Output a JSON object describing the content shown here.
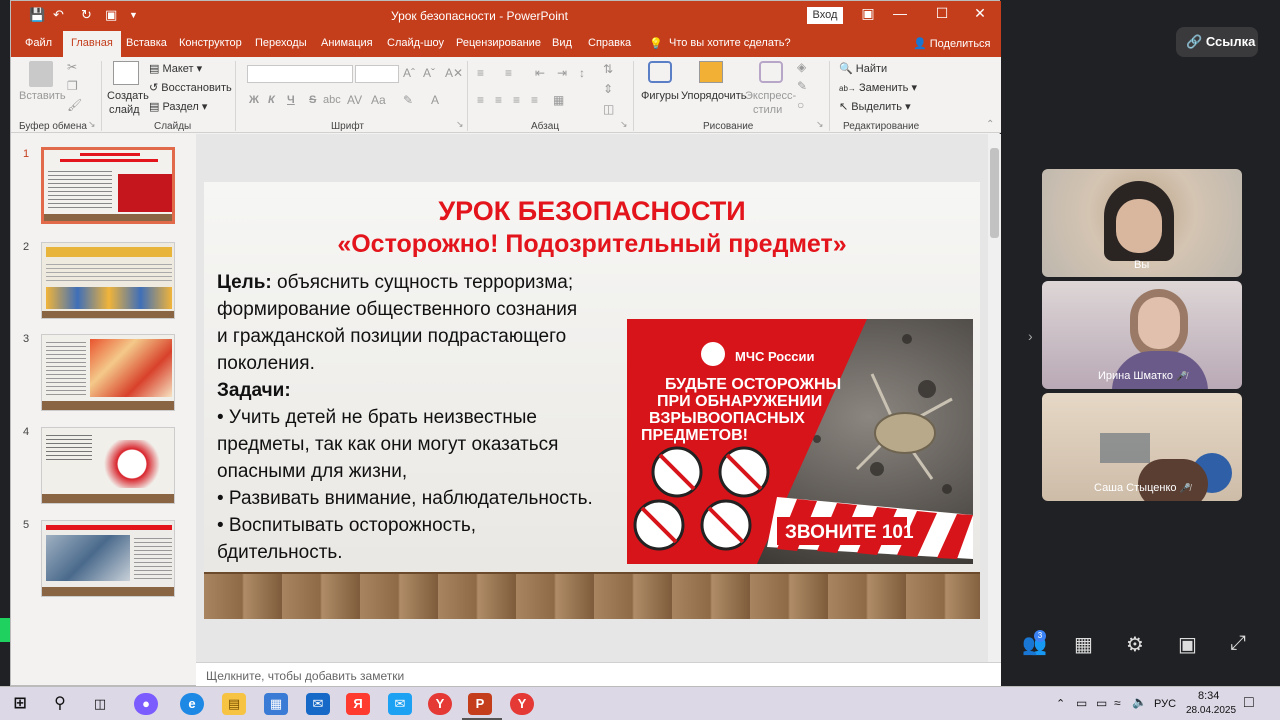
{
  "window": {
    "title": "Урок безопасности  -  PowerPoint",
    "signin": "Вход"
  },
  "qat": {
    "save": "save-icon",
    "undo": "undo-icon",
    "redo": "redo-icon"
  },
  "tabs": [
    "Файл",
    "Главная",
    "Вставка",
    "Конструктор",
    "Переходы",
    "Анимация",
    "Слайд-шоу",
    "Рецензирование",
    "Вид",
    "Справка"
  ],
  "tell_me": "Что вы хотите сделать?",
  "share": "Поделиться",
  "ribbon": {
    "clipboard": {
      "paste": "Вставить",
      "group": "Буфер обмена"
    },
    "slides": {
      "new_slide_1": "Создать",
      "new_slide_2": "слайд",
      "layout": "Макет",
      "reset": "Восстановить",
      "section": "Раздел",
      "group": "Слайды"
    },
    "font": {
      "bold": "Ж",
      "italic": "К",
      "underline": "Ч",
      "strike": "S",
      "shadow": "abc",
      "group": "Шрифт"
    },
    "paragraph": {
      "group": "Абзац"
    },
    "drawing": {
      "shapes": "Фигуры",
      "arrange": "Упорядочить",
      "styles_1": "Экспресс-",
      "styles_2": "стили",
      "group": "Рисование"
    },
    "editing": {
      "find": "Найти",
      "replace": "Заменить",
      "select": "Выделить",
      "group": "Редактирование"
    }
  },
  "thumbnails": [
    {
      "num": "1",
      "selected": true
    },
    {
      "num": "2",
      "selected": false
    },
    {
      "num": "3",
      "selected": false
    },
    {
      "num": "4",
      "selected": false
    },
    {
      "num": "5",
      "selected": false
    }
  ],
  "slide": {
    "title1": "УРОК БЕЗОПАСНОСТИ",
    "title2": "«Осторожно! Подозрительный предмет»",
    "goal_label": "Цель:",
    "goal_l1": " объяснить сущность терроризма;",
    "goal_l2": "формирование общественного сознания",
    "goal_l3": "и гражданской позиции подрастающего",
    "goal_l4": "поколения.",
    "tasks_label": "Задачи:",
    "t1_l1": "• Учить детей не брать неизвестные",
    "t1_l2": "предметы, так как они могут оказаться",
    "t1_l3": "опасными для жизни,",
    "t2": "• Развивать внимание, наблюдательность.",
    "t3_l1": "• Воспитывать осторожность,",
    "t3_l2": "бдительность.",
    "poster": {
      "org": "МЧС России",
      "l1": "БУДЬТЕ ОСТОРОЖНЫ",
      "l2": "ПРИ ОБНАРУЖЕНИИ",
      "l3": "ВЗРЫВООПАСНЫХ",
      "l4": "ПРЕДМЕТОВ!",
      "call": "ЗВОНИТЕ  101"
    }
  },
  "notes": "Щелкните, чтобы добавить заметки",
  "meeting": {
    "link": "Ссылка",
    "participants": [
      {
        "name": "Вы"
      },
      {
        "name": "Ирина Шматко"
      },
      {
        "name": "Саша Стыценко"
      }
    ],
    "participants_count": "3"
  },
  "tray": {
    "lang": "РУС",
    "time": "8:34",
    "date": "28.04.2025"
  },
  "colors": {
    "ppt_red": "#c43e1c",
    "slide_red": "#e3141b"
  }
}
